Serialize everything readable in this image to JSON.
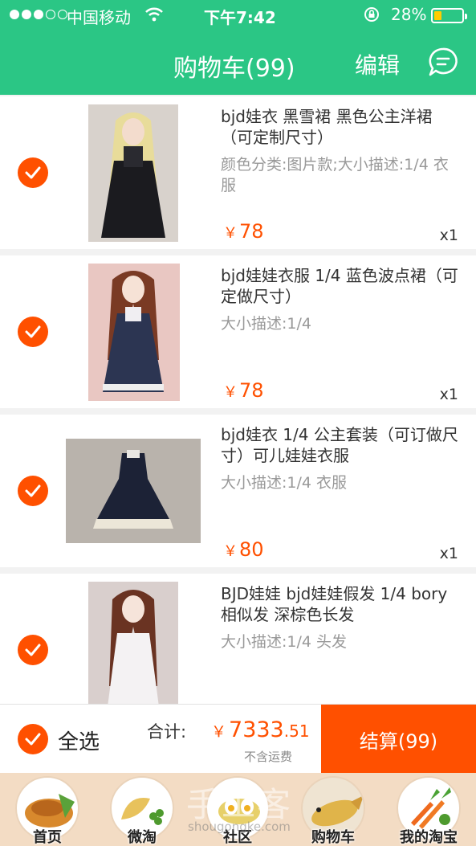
{
  "status_bar": {
    "carrier": "中国移动",
    "time": "下午7:42",
    "battery": "28%",
    "battery_level": 0.28
  },
  "nav": {
    "title": "购物车(99)",
    "edit_label": "编辑",
    "message_icon": "chat-bubble-icon"
  },
  "items": [
    {
      "title": "bjd娃衣 黑雪裙 黑色公主洋裙（可定制尺寸）",
      "sku": "颜色分类:图片款;大小描述:1/4  衣服",
      "price": "78",
      "qty": "x1",
      "checked": true
    },
    {
      "title": "bjd娃娃衣服  1/4  蓝色波点裙（可定做尺寸）",
      "sku": "大小描述:1/4",
      "price": "78",
      "qty": "x1",
      "checked": true
    },
    {
      "title": "bjd娃衣  1/4  公主套装（可订做尺寸）可儿娃娃衣服",
      "sku": "大小描述:1/4 衣服",
      "price": "80",
      "qty": "x1",
      "checked": true
    },
    {
      "title": "BJD娃娃 bjd娃娃假发 1/4 bory相似发 深棕色长发",
      "sku": "大小描述:1/4 头发",
      "price": "",
      "qty": "",
      "checked": true
    }
  ],
  "currency_symbol": "￥",
  "summary": {
    "select_all": "全选",
    "total_label": "合计:",
    "total_int": "7333",
    "total_cents": ".51",
    "shipping_note": "不含运费",
    "checkout_label": "结算(99)"
  },
  "tabs": [
    {
      "label": "首页",
      "icon": "home-food-icon"
    },
    {
      "label": "微淘",
      "icon": "weitao-food-icon"
    },
    {
      "label": "社区",
      "icon": "community-food-icon"
    },
    {
      "label": "购物车",
      "icon": "cart-food-icon"
    },
    {
      "label": "我的淘宝",
      "icon": "my-taobao-food-icon"
    }
  ],
  "watermark": {
    "text": "手工客",
    "url": "shougongke.com"
  },
  "colors": {
    "nav_green": "#2bc685",
    "accent_orange": "#ff5000",
    "tabbar_bg": "#f3dcc4"
  }
}
